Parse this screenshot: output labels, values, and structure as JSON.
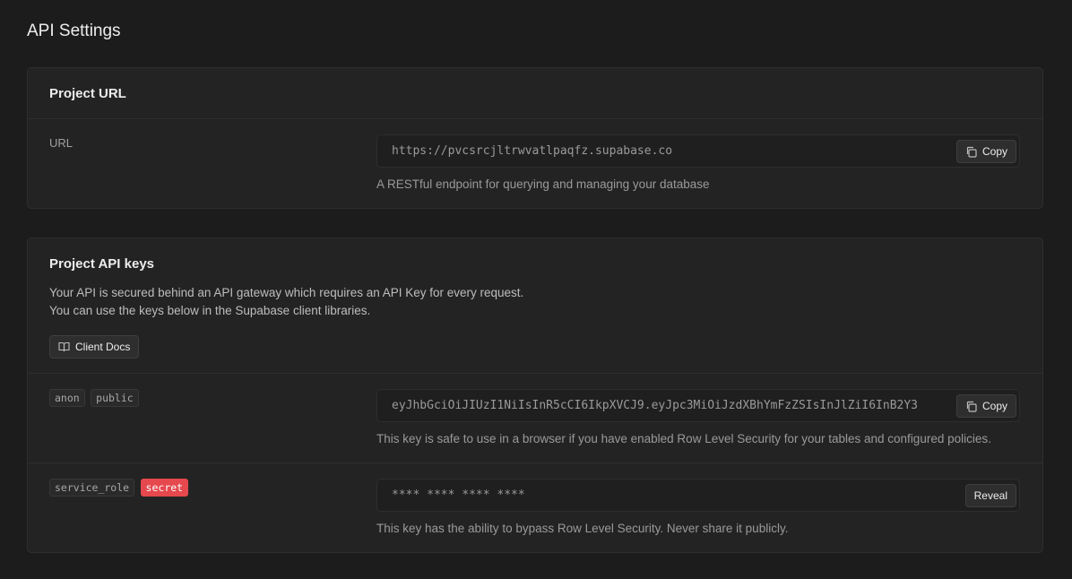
{
  "page": {
    "title": "API Settings"
  },
  "project_url": {
    "title": "Project URL",
    "label": "URL",
    "value": "https://pvcsrcjltrwvatlpaqfz.supabase.co",
    "copy_label": "Copy",
    "help": "A RESTful endpoint for querying and managing your database"
  },
  "api_keys": {
    "title": "Project API keys",
    "description_line1": "Your API is secured behind an API gateway which requires an API Key for every request.",
    "description_line2": "You can use the keys below in the Supabase client libraries.",
    "docs_button": "Client Docs",
    "anon": {
      "tags": [
        "anon",
        "public"
      ],
      "value": "eyJhbGciOiJIUzI1NiIsInR5cCI6IkpXVCJ9.eyJpc3MiOiJzdXBhYmFzZSIsInJlZiI6InB2Y3",
      "copy_label": "Copy",
      "help": "This key is safe to use in a browser if you have enabled Row Level Security for your tables and configured policies."
    },
    "service_role": {
      "tags": [
        "service_role",
        "secret"
      ],
      "value": "**** **** **** ****",
      "reveal_label": "Reveal",
      "help": "This key has the ability to bypass Row Level Security. Never share it publicly."
    }
  },
  "colors": {
    "background": "#1c1c1c",
    "panel": "#232323",
    "secret_badge": "#e5484d"
  }
}
